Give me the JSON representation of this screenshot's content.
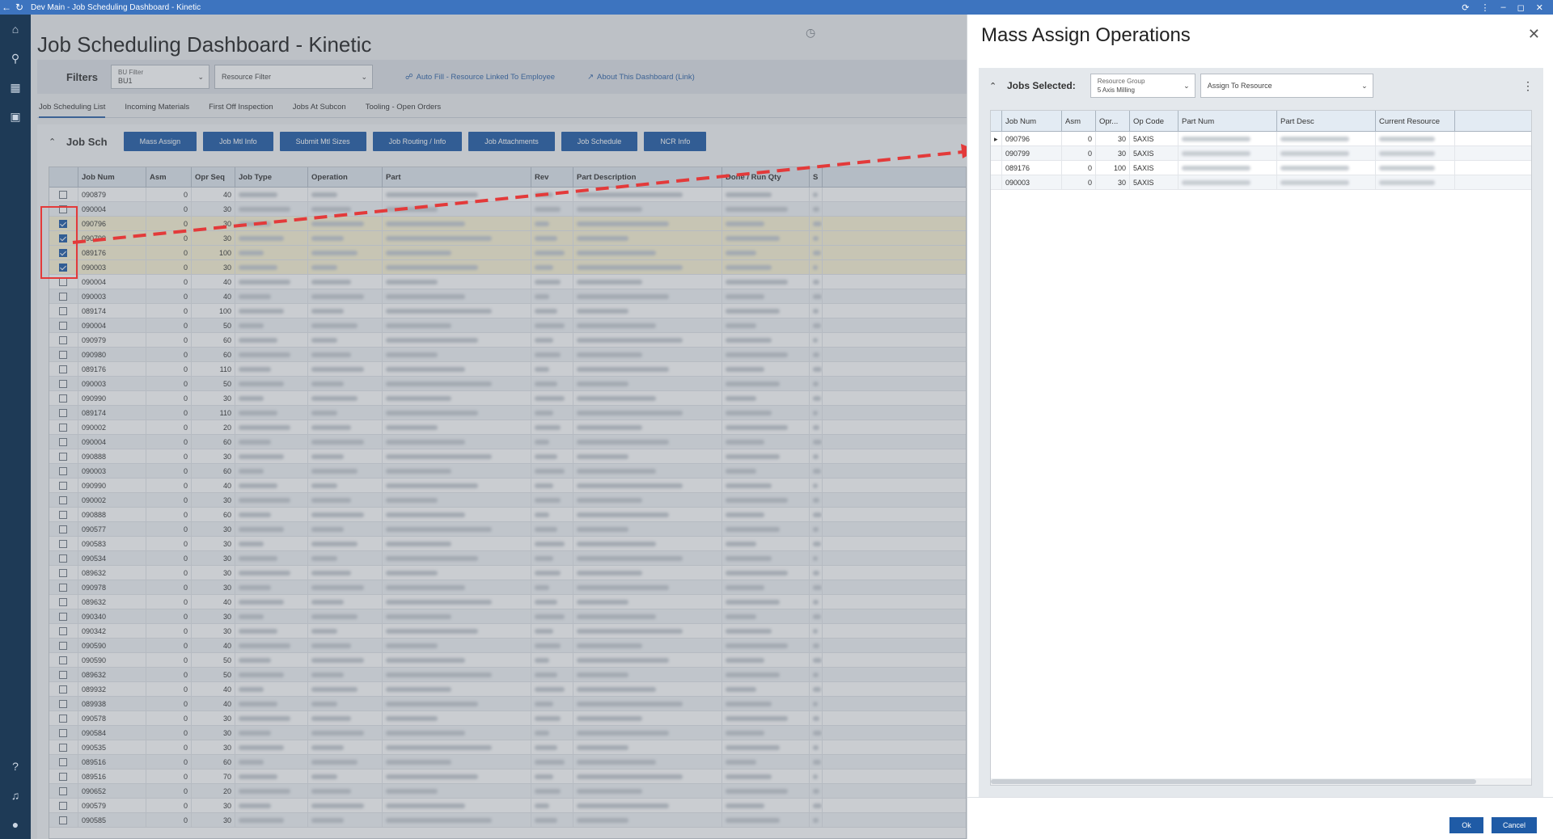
{
  "titlebar": {
    "title": "Dev Main - Job Scheduling Dashboard - Kinetic"
  },
  "page": {
    "title": "Job Scheduling Dashboard - Kinetic"
  },
  "filters": {
    "label": "Filters",
    "bu_filter_label": "BU Filter",
    "bu_filter_value": "BU1",
    "resource_filter_placeholder": "Resource Filter",
    "auto_fill_link": "Auto Fill - Resource Linked To Employee",
    "about_link": "About This Dashboard (Link)"
  },
  "tabs": [
    {
      "label": "Job Scheduling List"
    },
    {
      "label": "Incoming Materials"
    },
    {
      "label": "First Off Inspection"
    },
    {
      "label": "Jobs At Subcon"
    },
    {
      "label": "Tooling - Open Orders"
    }
  ],
  "section": {
    "title": "Job Sch"
  },
  "actions": [
    {
      "label": "Mass Assign"
    },
    {
      "label": "Job Mtl Info"
    },
    {
      "label": "Submit Mtl Sizes"
    },
    {
      "label": "Job Routing / Info"
    },
    {
      "label": "Job Attachments"
    },
    {
      "label": "Job Schedule"
    },
    {
      "label": "NCR Info"
    }
  ],
  "grid": {
    "columns": [
      "Job Num",
      "Asm",
      "Opr Seq",
      "Job Type",
      "Operation",
      "Part",
      "Rev",
      "Part Description",
      "Done / Run Qty",
      "S"
    ],
    "rows": [
      {
        "job": "090879",
        "asm": "0",
        "opr": "40",
        "checked": false,
        "selected": false
      },
      {
        "job": "090004",
        "asm": "0",
        "opr": "30",
        "checked": false,
        "selected": false
      },
      {
        "job": "090796",
        "asm": "0",
        "opr": "30",
        "checked": true,
        "selected": true
      },
      {
        "job": "090799",
        "asm": "0",
        "opr": "30",
        "checked": true,
        "selected": true
      },
      {
        "job": "089176",
        "asm": "0",
        "opr": "100",
        "checked": true,
        "selected": true
      },
      {
        "job": "090003",
        "asm": "0",
        "opr": "30",
        "checked": true,
        "selected": true
      },
      {
        "job": "090004",
        "asm": "0",
        "opr": "40",
        "checked": false,
        "selected": false
      },
      {
        "job": "090003",
        "asm": "0",
        "opr": "40",
        "checked": false,
        "selected": false
      },
      {
        "job": "089174",
        "asm": "0",
        "opr": "100",
        "checked": false,
        "selected": false
      },
      {
        "job": "090004",
        "asm": "0",
        "opr": "50",
        "checked": false,
        "selected": false
      },
      {
        "job": "090979",
        "asm": "0",
        "opr": "60",
        "checked": false,
        "selected": false
      },
      {
        "job": "090980",
        "asm": "0",
        "opr": "60",
        "checked": false,
        "selected": false
      },
      {
        "job": "089176",
        "asm": "0",
        "opr": "110",
        "checked": false,
        "selected": false
      },
      {
        "job": "090003",
        "asm": "0",
        "opr": "50",
        "checked": false,
        "selected": false
      },
      {
        "job": "090990",
        "asm": "0",
        "opr": "30",
        "checked": false,
        "selected": false
      },
      {
        "job": "089174",
        "asm": "0",
        "opr": "110",
        "checked": false,
        "selected": false
      },
      {
        "job": "090002",
        "asm": "0",
        "opr": "20",
        "checked": false,
        "selected": false
      },
      {
        "job": "090004",
        "asm": "0",
        "opr": "60",
        "checked": false,
        "selected": false
      },
      {
        "job": "090888",
        "asm": "0",
        "opr": "30",
        "checked": false,
        "selected": false
      },
      {
        "job": "090003",
        "asm": "0",
        "opr": "60",
        "checked": false,
        "selected": false
      },
      {
        "job": "090990",
        "asm": "0",
        "opr": "40",
        "checked": false,
        "selected": false
      },
      {
        "job": "090002",
        "asm": "0",
        "opr": "30",
        "checked": false,
        "selected": false
      },
      {
        "job": "090888",
        "asm": "0",
        "opr": "60",
        "checked": false,
        "selected": false
      },
      {
        "job": "090577",
        "asm": "0",
        "opr": "30",
        "checked": false,
        "selected": false
      },
      {
        "job": "090583",
        "asm": "0",
        "opr": "30",
        "checked": false,
        "selected": false
      },
      {
        "job": "090534",
        "asm": "0",
        "opr": "30",
        "checked": false,
        "selected": false
      },
      {
        "job": "089632",
        "asm": "0",
        "opr": "30",
        "checked": false,
        "selected": false
      },
      {
        "job": "090978",
        "asm": "0",
        "opr": "30",
        "checked": false,
        "selected": false
      },
      {
        "job": "089632",
        "asm": "0",
        "opr": "40",
        "checked": false,
        "selected": false
      },
      {
        "job": "090340",
        "asm": "0",
        "opr": "30",
        "checked": false,
        "selected": false
      },
      {
        "job": "090342",
        "asm": "0",
        "opr": "30",
        "checked": false,
        "selected": false
      },
      {
        "job": "090590",
        "asm": "0",
        "opr": "40",
        "checked": false,
        "selected": false
      },
      {
        "job": "090590",
        "asm": "0",
        "opr": "50",
        "checked": false,
        "selected": false
      },
      {
        "job": "089632",
        "asm": "0",
        "opr": "50",
        "checked": false,
        "selected": false
      },
      {
        "job": "089932",
        "asm": "0",
        "opr": "40",
        "checked": false,
        "selected": false
      },
      {
        "job": "089938",
        "asm": "0",
        "opr": "40",
        "checked": false,
        "selected": false
      },
      {
        "job": "090578",
        "asm": "0",
        "opr": "30",
        "checked": false,
        "selected": false
      },
      {
        "job": "090584",
        "asm": "0",
        "opr": "30",
        "checked": false,
        "selected": false
      },
      {
        "job": "090535",
        "asm": "0",
        "opr": "30",
        "checked": false,
        "selected": false
      },
      {
        "job": "089516",
        "asm": "0",
        "opr": "60",
        "checked": false,
        "selected": false
      },
      {
        "job": "089516",
        "asm": "0",
        "opr": "70",
        "checked": false,
        "selected": false
      },
      {
        "job": "090652",
        "asm": "0",
        "opr": "20",
        "checked": false,
        "selected": false
      },
      {
        "job": "090579",
        "asm": "0",
        "opr": "30",
        "checked": false,
        "selected": false
      },
      {
        "job": "090585",
        "asm": "0",
        "opr": "30",
        "checked": false,
        "selected": false
      }
    ]
  },
  "panel": {
    "title": "Mass Assign Operations",
    "jobs_selected_label": "Jobs Selected:",
    "resource_group_label": "Resource Group",
    "resource_group_value": "5 Axis Milling",
    "assign_placeholder": "Assign To Resource",
    "columns": [
      "Job Num",
      "Asm",
      "Opr...",
      "Op Code",
      "Part Num",
      "Part Desc",
      "Current Resource"
    ],
    "rows": [
      {
        "job": "090796",
        "asm": "0",
        "opr": "30",
        "op": "5AXIS"
      },
      {
        "job": "090799",
        "asm": "0",
        "opr": "30",
        "op": "5AXIS"
      },
      {
        "job": "089176",
        "asm": "0",
        "opr": "100",
        "op": "5AXIS"
      },
      {
        "job": "090003",
        "asm": "0",
        "opr": "30",
        "op": "5AXIS"
      }
    ],
    "ok_label": "Ok",
    "cancel_label": "Cancel"
  },
  "colors": {
    "accent": "#1f5ba6",
    "titlebar": "#3d74bf",
    "nav": "#1e3a56",
    "highlight": "#e33a3a"
  }
}
